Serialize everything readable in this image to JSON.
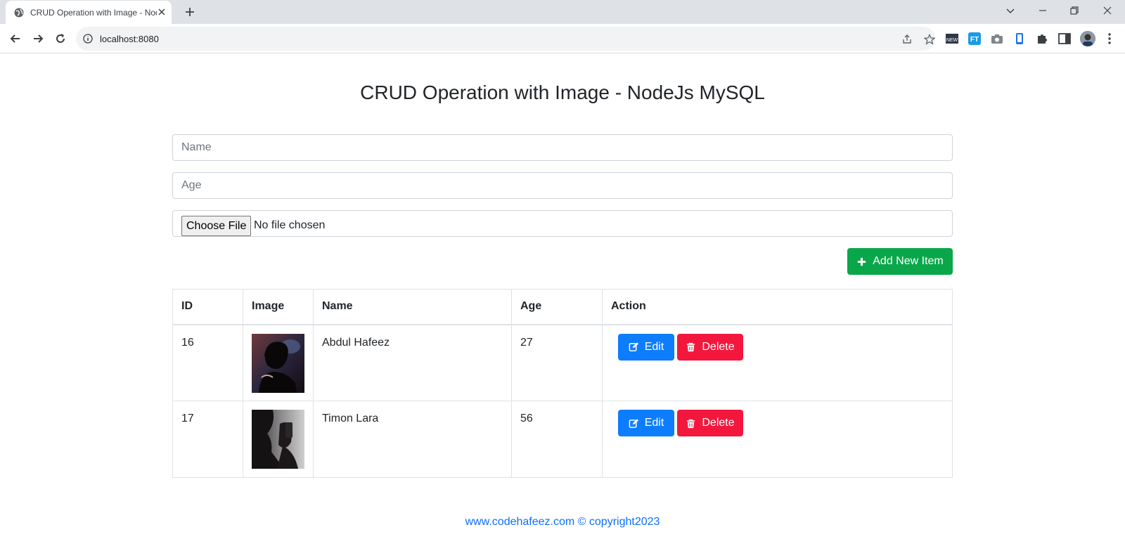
{
  "browser": {
    "tab_title": "CRUD Operation with Image - NodeJs MySQL",
    "url": "localhost:8080"
  },
  "page": {
    "title": "CRUD Operation with Image - NodeJs MySQL"
  },
  "form": {
    "name_placeholder": "Name",
    "age_placeholder": "Age",
    "file_button": "Choose File",
    "file_status": "No file chosen",
    "add_button": "Add New Item"
  },
  "table": {
    "headers": [
      "ID",
      "Image",
      "Name",
      "Age",
      "Action"
    ],
    "rows": [
      {
        "id": "16",
        "image_icon": "person-silhouette-photo",
        "name": "Abdul Hafeez",
        "age": "27",
        "edit": "Edit",
        "delete": "Delete"
      },
      {
        "id": "17",
        "image_icon": "person-shadow-photo",
        "name": "Timon Lara",
        "age": "56",
        "edit": "Edit",
        "delete": "Delete"
      }
    ]
  },
  "footer": {
    "text": "www.codehafeez.com © copyright2023"
  },
  "colors": {
    "add_button": "#0aa74a",
    "edit_button": "#0d7dfd",
    "delete_button": "#f3173e",
    "footer_link": "#0d6efd"
  }
}
